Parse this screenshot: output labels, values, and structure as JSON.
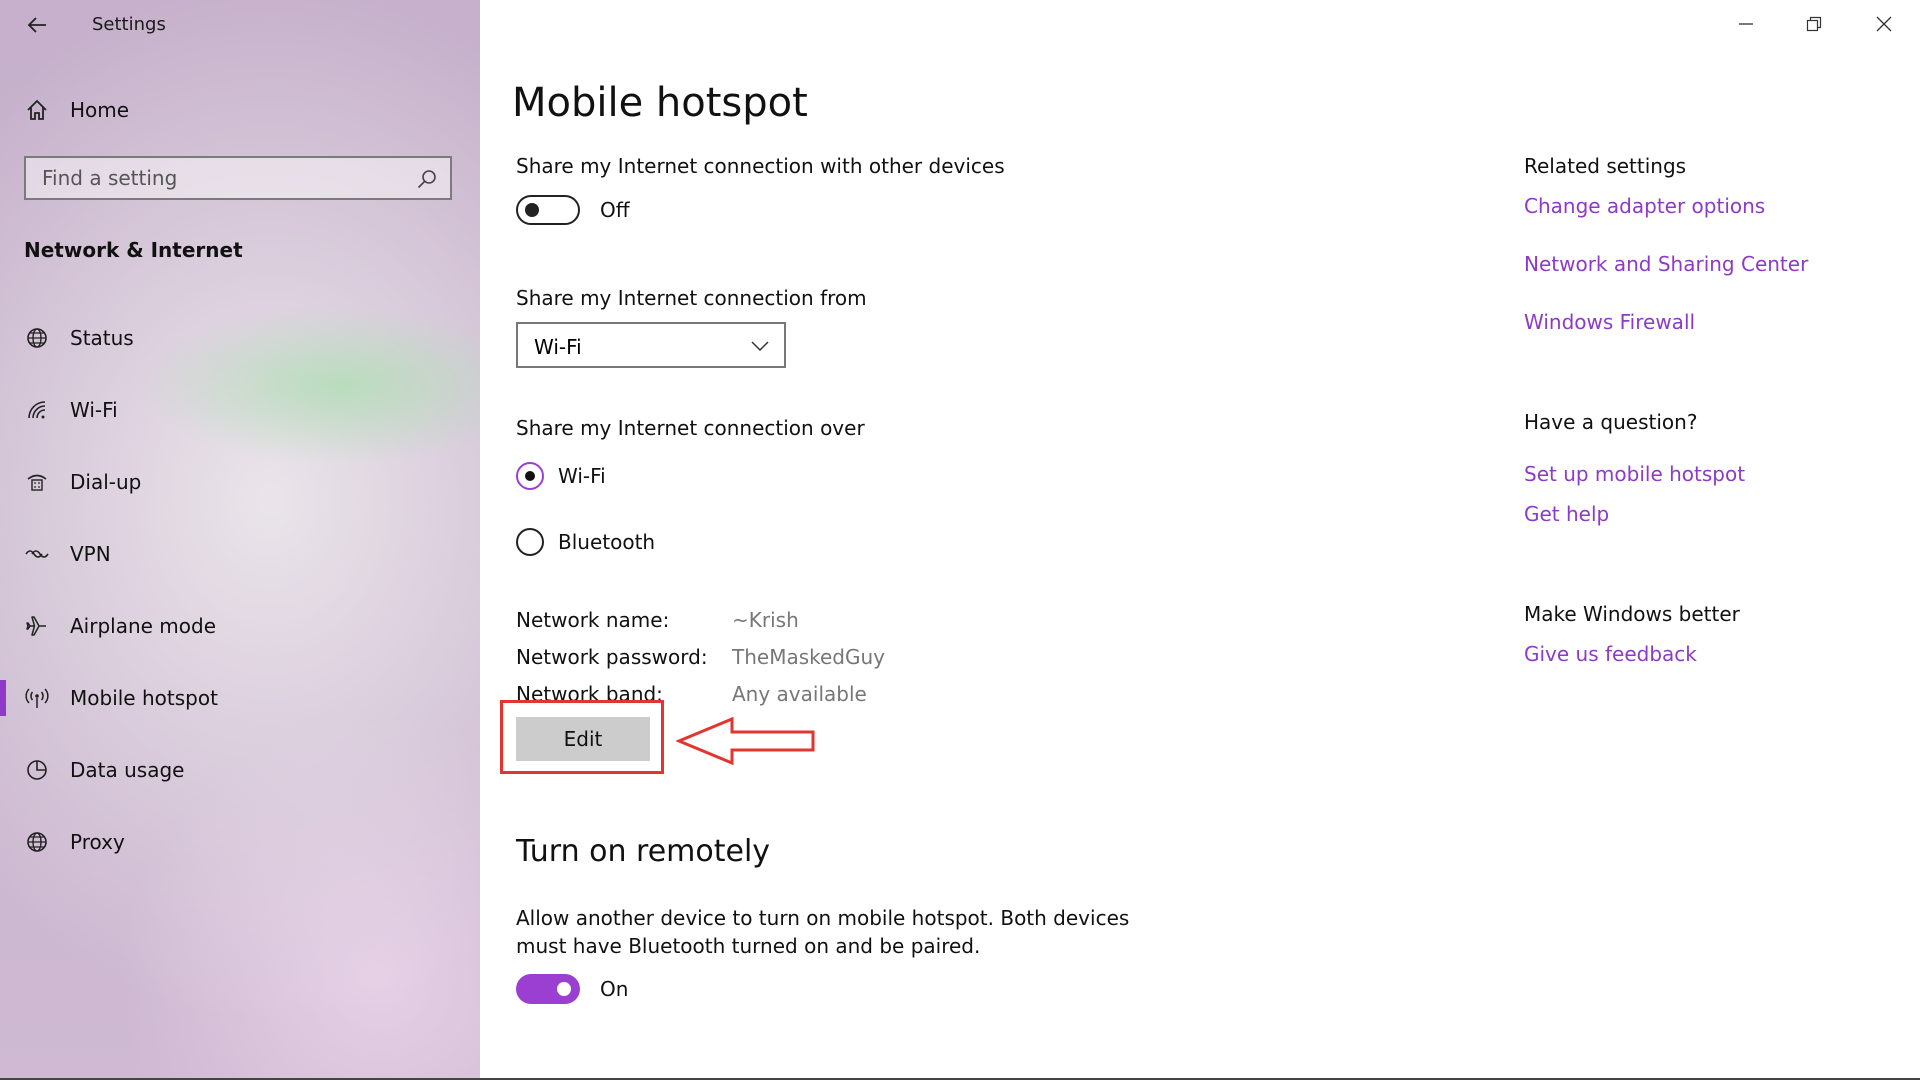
{
  "window": {
    "title": "Settings"
  },
  "sidebar": {
    "home_label": "Home",
    "search_placeholder": "Find a setting",
    "section_title": "Network & Internet",
    "items": [
      {
        "label": "Status",
        "icon": "globe-status-icon"
      },
      {
        "label": "Wi-Fi",
        "icon": "wifi-icon"
      },
      {
        "label": "Dial-up",
        "icon": "dialup-icon"
      },
      {
        "label": "VPN",
        "icon": "vpn-icon"
      },
      {
        "label": "Airplane mode",
        "icon": "airplane-icon"
      },
      {
        "label": "Mobile hotspot",
        "icon": "hotspot-icon"
      },
      {
        "label": "Data usage",
        "icon": "data-usage-icon"
      },
      {
        "label": "Proxy",
        "icon": "globe-icon"
      }
    ],
    "active_item": "Mobile hotspot"
  },
  "main": {
    "page_title": "Mobile hotspot",
    "share_label": "Share my Internet connection with other devices",
    "share_toggle_state": "Off",
    "share_from_label": "Share my Internet connection from",
    "share_from_value": "Wi-Fi",
    "share_over_label": "Share my Internet connection over",
    "share_over_options": [
      "Wi-Fi",
      "Bluetooth"
    ],
    "share_over_selected": "Wi-Fi",
    "network_name_label": "Network name:",
    "network_name_value": "~Krish",
    "network_password_label": "Network password:",
    "network_password_value": "TheMaskedGuy",
    "network_band_label": "Network band:",
    "network_band_value": "Any available",
    "edit_label": "Edit",
    "remote_title": "Turn on remotely",
    "remote_desc": "Allow another device to turn on mobile hotspot. Both devices must have Bluetooth turned on and be paired.",
    "remote_toggle_state": "On"
  },
  "related": {
    "heading": "Related settings",
    "links": [
      "Change adapter options",
      "Network and Sharing Center",
      "Windows Firewall"
    ],
    "question_heading": "Have a question?",
    "question_links": [
      "Set up mobile hotspot",
      "Get help"
    ],
    "better_heading": "Make Windows better",
    "better_links": [
      "Give us feedback"
    ]
  },
  "colors": {
    "accent": "#9b3fd3",
    "link": "#8e3ac6",
    "annotation": "#e3342f"
  }
}
